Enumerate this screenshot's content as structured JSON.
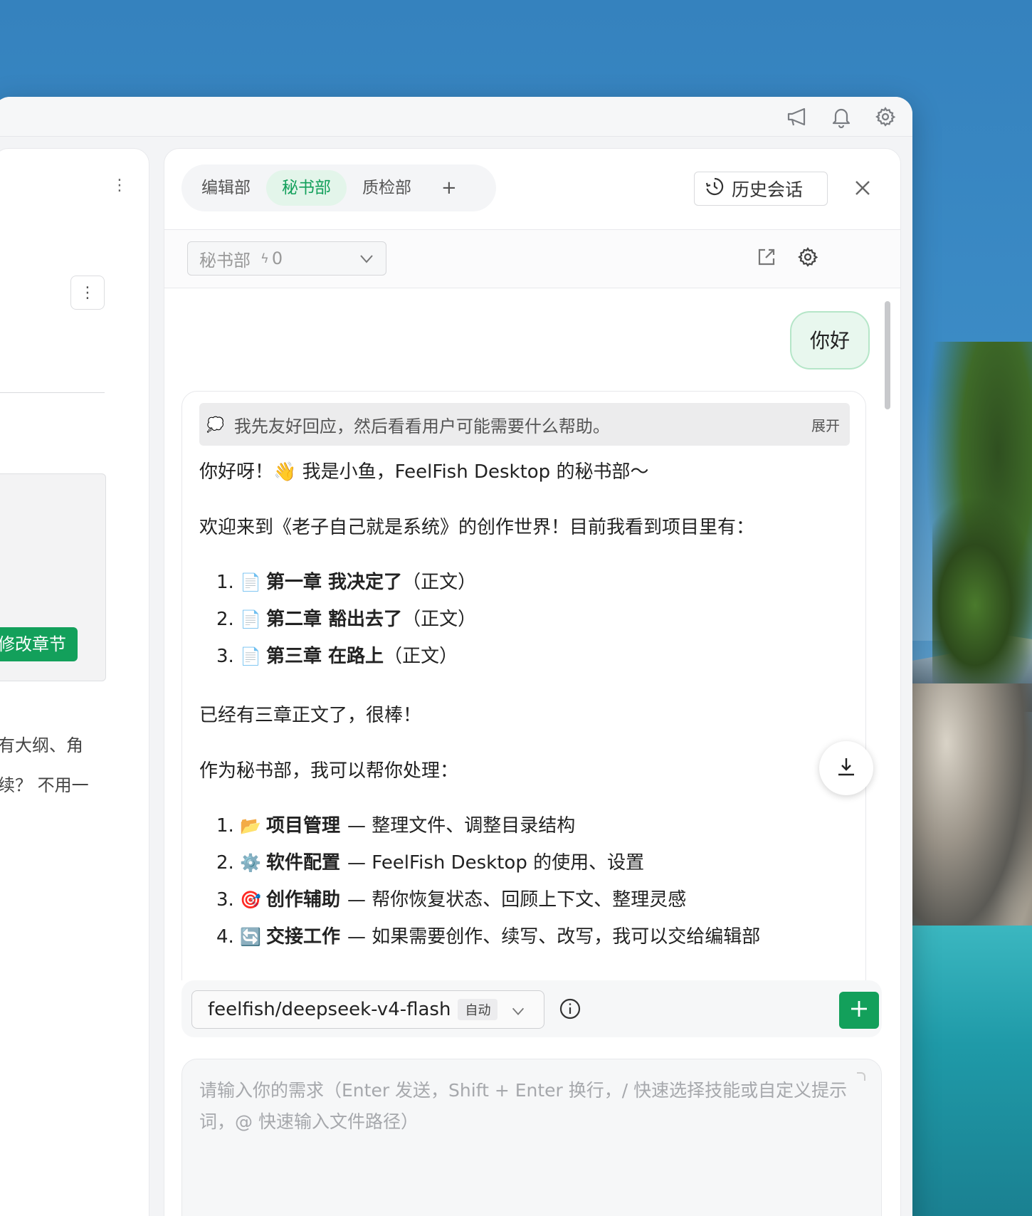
{
  "left_panel": {
    "tag_label": "修改章节",
    "text_line_1": "有大纲、角",
    "text_line_2": "续？ 不用一"
  },
  "tabs": [
    {
      "label": "编辑部"
    },
    {
      "label": "秘书部",
      "active": true
    },
    {
      "label": "质检部"
    }
  ],
  "tab_add": "+",
  "history_label": "历史会话",
  "agent_select": {
    "name": "秘书部",
    "bolt": "ϟ",
    "count": "0"
  },
  "messages": {
    "user": "你好",
    "thinking": "我先友好回应，然后看看用户可能需要什么帮助。",
    "expand_label": "展开",
    "greeting": "你好呀！👋 我是小鱼，FeelFish Desktop 的秘书部～",
    "intro": "欢迎来到《老子自己就是系统》的创作世界！目前我看到项目里有：",
    "chapters": [
      {
        "num": "1.",
        "icon": "📄",
        "title": "第一章 我决定了",
        "note": "（正文）"
      },
      {
        "num": "2.",
        "icon": "📄",
        "title": "第二章 豁出去了",
        "note": "（正文）"
      },
      {
        "num": "3.",
        "icon": "📄",
        "title": "第三章 在路上",
        "note": "（正文）"
      }
    ],
    "praise": "已经有三章正文了，很棒！",
    "role_intro": "作为秘书部，我可以帮你处理：",
    "services": [
      {
        "num": "1.",
        "icon": "📂",
        "title": "项目管理",
        "desc": "— 整理文件、调整目录结构"
      },
      {
        "num": "2.",
        "icon": "⚙️",
        "title": "软件配置",
        "desc": "— FeelFish Desktop 的使用、设置"
      },
      {
        "num": "3.",
        "icon": "🎯",
        "title": "创作辅助",
        "desc": "— 帮你恢复状态、回顾上下文、整理灵感"
      },
      {
        "num": "4.",
        "icon": "🔄",
        "title": "交接工作",
        "desc": "— 如果需要创作、续写、改写，我可以交给编辑部"
      }
    ]
  },
  "model": {
    "name": "feelfish/deepseek-v4-flash",
    "mode": "自动"
  },
  "input": {
    "value": "",
    "placeholder": "请输入你的需求（Enter 发送，Shift + Enter 换行，/ 快速选择技能或自定义提示词，@ 快速输入文件路径）"
  },
  "colors": {
    "accent": "#13a05b",
    "user_bubble": "#e8f7ee",
    "wallpaper": "#3a87c2"
  },
  "icons": [
    "megaphone-icon",
    "bell-icon",
    "gear-icon",
    "clock-icon",
    "close-icon",
    "external-link-icon",
    "chevron-down-icon",
    "download-icon",
    "info-icon",
    "plus-icon",
    "more-vertical-icon"
  ]
}
